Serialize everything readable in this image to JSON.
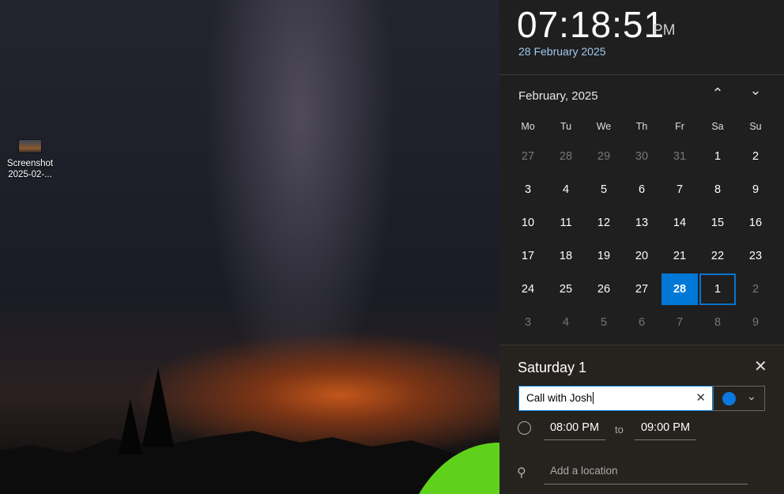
{
  "desktop": {
    "icons": [
      {
        "label1": "Screenshot",
        "label2": "2025-02-...",
        "icon": "image-file-icon"
      }
    ]
  },
  "clock": {
    "time": "07:18:51",
    "ampm": "PM",
    "date": "28 February 2025"
  },
  "calendar": {
    "month": "February, 2025",
    "prev_icon": "chevron-up-icon",
    "next_icon": "chevron-down-icon",
    "weekdays": [
      "Mo",
      "Tu",
      "We",
      "Th",
      "Fr",
      "Sa",
      "Su"
    ],
    "days": [
      [
        "27",
        "28",
        "29",
        "30",
        "31",
        "1",
        "2"
      ],
      [
        "3",
        "4",
        "5",
        "6",
        "7",
        "8",
        "9"
      ],
      [
        "10",
        "11",
        "12",
        "13",
        "14",
        "15",
        "16"
      ],
      [
        "17",
        "18",
        "19",
        "20",
        "21",
        "22",
        "23"
      ],
      [
        "24",
        "25",
        "26",
        "27",
        "28",
        "1",
        "2"
      ],
      [
        "3",
        "4",
        "5",
        "6",
        "7",
        "8",
        "9"
      ]
    ],
    "today": "28",
    "selected": "1"
  },
  "event": {
    "title": "Saturday 1",
    "name_value": "Call with Josh",
    "color": "#0a78e0",
    "start": "08:00 PM",
    "to": "to",
    "end": "09:00 PM",
    "location_placeholder": "Add a location"
  }
}
